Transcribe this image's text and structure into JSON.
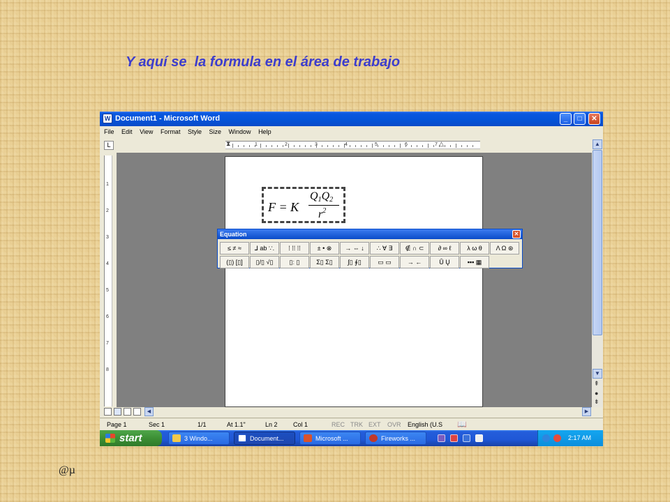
{
  "slide": {
    "title": "Y aquí se  la formula en el área de trabajo",
    "footer": "@µ"
  },
  "window": {
    "title": "Document1 - Microsoft Word",
    "app_icon": "word-icon",
    "minimize": "_",
    "maximize": "□",
    "close": "✕"
  },
  "menu": [
    "File",
    "Edit",
    "View",
    "Format",
    "Style",
    "Size",
    "Window",
    "Help"
  ],
  "ruler": {
    "tab_marker": "L",
    "h_numbers": [
      "1",
      "2",
      "3",
      "4",
      "5",
      "6",
      "7"
    ],
    "v_numbers": [
      "1",
      "2",
      "3",
      "4",
      "5",
      "6",
      "7",
      "8"
    ]
  },
  "equation": {
    "lhs": "F = K",
    "num_a": "Q",
    "num_a_sub": "1",
    "num_b": "Q",
    "num_b_sub": "2",
    "den": "r",
    "den_sup": "2"
  },
  "equation_toolbar": {
    "title": "Equation",
    "close": "✕",
    "row1": [
      "≤ ≠ ≈",
      "⅃ ab ∵.",
      "⁞ ⁞⁞ ⁞⁞",
      "± • ⊗",
      "→ ⇔ ↓",
      "∴ ∀ ∃",
      "∉ ∩ ⊂",
      "∂ ∞ ℓ",
      "λ ω θ",
      "Λ Ω ⊛"
    ],
    "row2": [
      "(▯) [▯]",
      "▯/▯ √▯",
      "▯ː ▯",
      "Σ▯ Σ▯",
      "∫▯ ∮▯",
      "▭ ▭",
      "→ ←",
      "Ū Ų",
      "▪▪▪ ▦"
    ]
  },
  "statusbar": {
    "page": "Page 1",
    "sec": "Sec 1",
    "pages": "1/1",
    "at": "At 1.1\"",
    "ln": "Ln 2",
    "col": "Col 1",
    "rec": "REC",
    "trk": "TRK",
    "ext": "EXT",
    "ovr": "OVR",
    "lang": "English (U.S"
  },
  "taskbar": {
    "start": "start",
    "buttons": [
      {
        "label": "3 Windo...",
        "icon_color": "#f2c94c"
      },
      {
        "label": "Document...",
        "icon_color": "#2b5fcf"
      },
      {
        "label": "Microsoft ...",
        "icon_color": "#d9532c"
      },
      {
        "label": "Fireworks ...",
        "icon_color": "#c0392b"
      }
    ],
    "clock": "2:17 AM"
  }
}
